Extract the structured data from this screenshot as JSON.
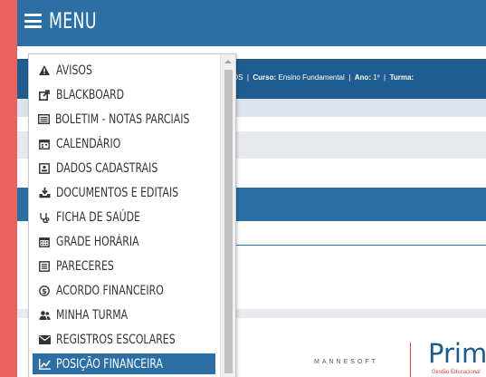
{
  "header": {
    "menu_label": "MENU"
  },
  "infobar": {
    "name_tail": "ANTOS",
    "curso_label": "Curso:",
    "curso_value": "Ensino Fundamental",
    "ano_label": "Ano:",
    "ano_value": "1º",
    "turma_label": "Turma:"
  },
  "menu": {
    "items": [
      {
        "label": "AVISOS",
        "icon": "warning-icon"
      },
      {
        "label": "BLACKBOARD",
        "icon": "external-link-icon"
      },
      {
        "label": "BOLETIM - NOTAS PARCIAIS",
        "icon": "list-icon"
      },
      {
        "label": "CALENDÁRIO",
        "icon": "calendar-icon"
      },
      {
        "label": "DADOS CADASTRAIS",
        "icon": "id-card-icon"
      },
      {
        "label": "DOCUMENTOS E EDITAIS",
        "icon": "download-tray-icon"
      },
      {
        "label": "FICHA DE SAÚDE",
        "icon": "stethoscope-icon"
      },
      {
        "label": "GRADE HORÁRIA",
        "icon": "calendar-grid-icon"
      },
      {
        "label": "PARECERES",
        "icon": "document-icon"
      },
      {
        "label": "ACORDO FINANCEIRO",
        "icon": "dollar-circle-icon"
      },
      {
        "label": "MINHA TURMA",
        "icon": "users-icon"
      },
      {
        "label": "REGISTROS ESCOLARES",
        "icon": "envelope-icon"
      },
      {
        "label": "POSIÇÃO FINANCEIRA",
        "icon": "line-chart-icon"
      }
    ],
    "active_index": 12
  },
  "footer": {
    "brand": "MANNESOFT",
    "logo": "Prime",
    "sub": "Gestão Educacional"
  }
}
